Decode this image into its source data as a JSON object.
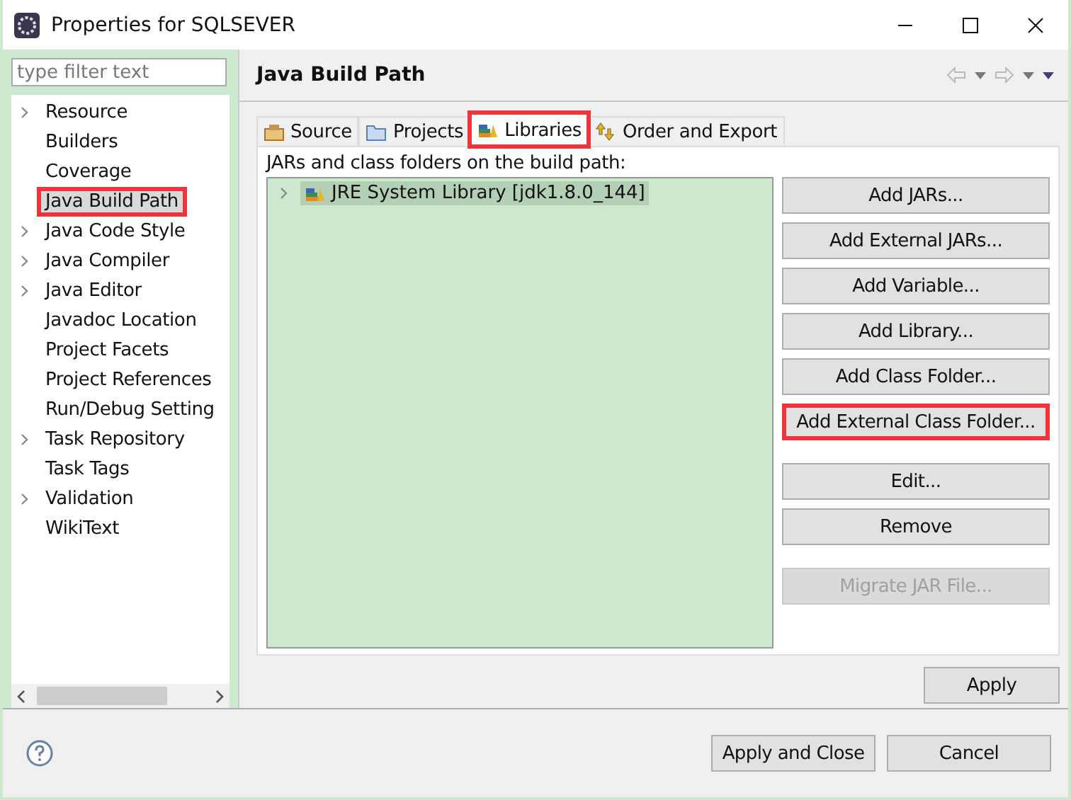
{
  "window": {
    "title": "Properties for SQLSEVER"
  },
  "filter": {
    "placeholder": "type filter text"
  },
  "sidebar": {
    "items": [
      {
        "label": "Resource",
        "expandable": true,
        "selected": false,
        "highlighted": false
      },
      {
        "label": "Builders",
        "expandable": false,
        "selected": false,
        "highlighted": false
      },
      {
        "label": "Coverage",
        "expandable": false,
        "selected": false,
        "highlighted": false
      },
      {
        "label": "Java Build Path",
        "expandable": false,
        "selected": true,
        "highlighted": true
      },
      {
        "label": "Java Code Style",
        "expandable": true,
        "selected": false,
        "highlighted": false
      },
      {
        "label": "Java Compiler",
        "expandable": true,
        "selected": false,
        "highlighted": false
      },
      {
        "label": "Java Editor",
        "expandable": true,
        "selected": false,
        "highlighted": false
      },
      {
        "label": "Javadoc Location",
        "expandable": false,
        "selected": false,
        "highlighted": false
      },
      {
        "label": "Project Facets",
        "expandable": false,
        "selected": false,
        "highlighted": false
      },
      {
        "label": "Project References",
        "expandable": false,
        "selected": false,
        "highlighted": false
      },
      {
        "label": "Run/Debug Setting",
        "expandable": false,
        "selected": false,
        "highlighted": false
      },
      {
        "label": "Task Repository",
        "expandable": true,
        "selected": false,
        "highlighted": false
      },
      {
        "label": "Task Tags",
        "expandable": false,
        "selected": false,
        "highlighted": false
      },
      {
        "label": "Validation",
        "expandable": true,
        "selected": false,
        "highlighted": false
      },
      {
        "label": "WikiText",
        "expandable": false,
        "selected": false,
        "highlighted": false
      }
    ]
  },
  "page": {
    "title": "Java Build Path",
    "tabs": [
      {
        "label": "Source",
        "kind": "source",
        "selected": false,
        "highlighted": false
      },
      {
        "label": "Projects",
        "kind": "projects",
        "selected": false,
        "highlighted": false
      },
      {
        "label": "Libraries",
        "kind": "libraries",
        "selected": true,
        "highlighted": true
      },
      {
        "label": "Order and Export",
        "kind": "order",
        "selected": false,
        "highlighted": false
      }
    ],
    "list_label": "JARs and class folders on the build path:",
    "entries": [
      {
        "label": "JRE System Library [jdk1.8.0_144]",
        "expandable": true,
        "selected": true
      }
    ],
    "buttons": [
      {
        "label": "Add JARs...",
        "disabled": false,
        "highlighted": false,
        "gap_before": false
      },
      {
        "label": "Add External JARs...",
        "disabled": false,
        "highlighted": false,
        "gap_before": false
      },
      {
        "label": "Add Variable...",
        "disabled": false,
        "highlighted": false,
        "gap_before": false
      },
      {
        "label": "Add Library...",
        "disabled": false,
        "highlighted": false,
        "gap_before": false
      },
      {
        "label": "Add Class Folder...",
        "disabled": false,
        "highlighted": false,
        "gap_before": false
      },
      {
        "label": "Add External Class Folder...",
        "disabled": false,
        "highlighted": true,
        "gap_before": false
      },
      {
        "label": "Edit...",
        "disabled": false,
        "highlighted": false,
        "gap_before": true
      },
      {
        "label": "Remove",
        "disabled": false,
        "highlighted": false,
        "gap_before": false
      },
      {
        "label": "Migrate JAR File...",
        "disabled": true,
        "highlighted": false,
        "gap_before": true
      }
    ],
    "apply": {
      "label": "Apply"
    }
  },
  "footer": {
    "buttons": [
      {
        "label": "Apply and Close"
      },
      {
        "label": "Cancel"
      }
    ]
  }
}
